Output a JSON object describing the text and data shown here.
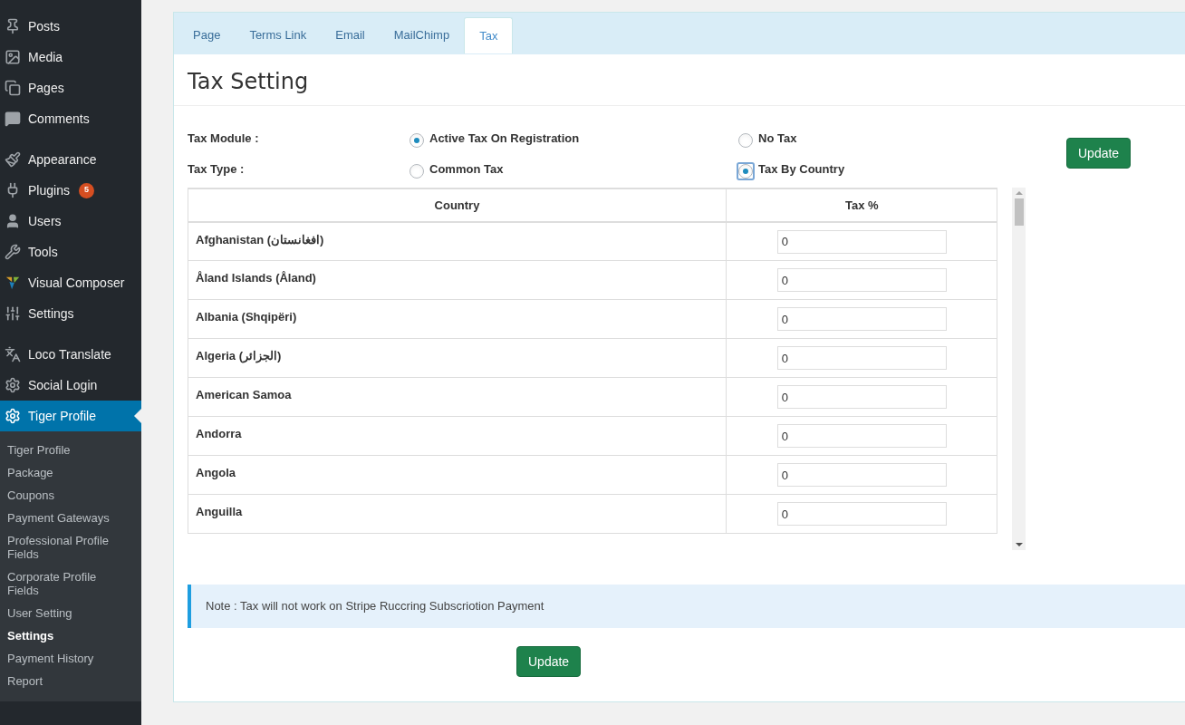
{
  "sidebar": {
    "groups": [
      [
        {
          "label": "Posts",
          "kind": "pin",
          "selected": false
        },
        {
          "label": "Media",
          "kind": "media",
          "selected": false
        },
        {
          "label": "Pages",
          "kind": "pages",
          "selected": false
        },
        {
          "label": "Comments",
          "kind": "comment",
          "selected": false
        }
      ],
      [
        {
          "label": "Appearance",
          "kind": "brush",
          "selected": false
        },
        {
          "label": "Plugins",
          "kind": "plug",
          "selected": false,
          "badge": "5"
        },
        {
          "label": "Users",
          "kind": "user",
          "selected": false
        },
        {
          "label": "Tools",
          "kind": "wrench",
          "selected": false
        },
        {
          "label": "Visual Composer",
          "kind": "vc",
          "selected": false
        },
        {
          "label": "Settings",
          "kind": "sliders",
          "selected": false
        }
      ],
      [
        {
          "label": "Loco Translate",
          "kind": "translate",
          "selected": false
        },
        {
          "label": "Social Login",
          "kind": "gear",
          "selected": false
        },
        {
          "label": "Tiger Profile",
          "kind": "gear",
          "selected": true
        }
      ]
    ],
    "submenu": [
      {
        "label": "Tiger Profile",
        "selected": false
      },
      {
        "label": "Package",
        "selected": false
      },
      {
        "label": "Coupons",
        "selected": false
      },
      {
        "label": "Payment Gateways",
        "selected": false
      },
      {
        "label": "Professional Profile Fields",
        "selected": false
      },
      {
        "label": "Corporate Profile Fields",
        "selected": false
      },
      {
        "label": "User Setting",
        "selected": false
      },
      {
        "label": "Settings",
        "selected": true
      },
      {
        "label": "Payment History",
        "selected": false
      },
      {
        "label": "Report",
        "selected": false
      }
    ]
  },
  "tabs": [
    {
      "label": "Page",
      "selected": false
    },
    {
      "label": "Terms Link",
      "selected": false
    },
    {
      "label": "Email",
      "selected": false
    },
    {
      "label": "MailChimp",
      "selected": false
    },
    {
      "label": "Tax",
      "selected": true
    }
  ],
  "title": "Tax Setting",
  "fields": [
    {
      "label": "Tax Module :",
      "options": [
        {
          "label": "Active Tax On Registration",
          "selected": true,
          "focused": false
        },
        {
          "label": "No Tax",
          "selected": false,
          "focused": false
        }
      ]
    },
    {
      "label": "Tax Type :",
      "options": [
        {
          "label": "Common Tax",
          "selected": false,
          "focused": false
        },
        {
          "label": "Tax By Country",
          "selected": true,
          "focused": true
        }
      ]
    }
  ],
  "update_button": "Update",
  "table": {
    "columns": [
      "Country",
      "Tax %"
    ],
    "rows": [
      {
        "country": "Afghanistan (افغانستان)",
        "tax": "0"
      },
      {
        "country": "Åland Islands (Åland)",
        "tax": "0"
      },
      {
        "country": "Albania (Shqipëri)",
        "tax": "0"
      },
      {
        "country": "Algeria (الجزائر)",
        "tax": "0"
      },
      {
        "country": "American Samoa",
        "tax": "0"
      },
      {
        "country": "Andorra",
        "tax": "0"
      },
      {
        "country": "Angola",
        "tax": "0"
      },
      {
        "country": "Anguilla",
        "tax": "0"
      }
    ]
  },
  "note": "Note : Tax will not work on Stripe Ruccring Subscriotion Payment",
  "bottom_button": "Update"
}
